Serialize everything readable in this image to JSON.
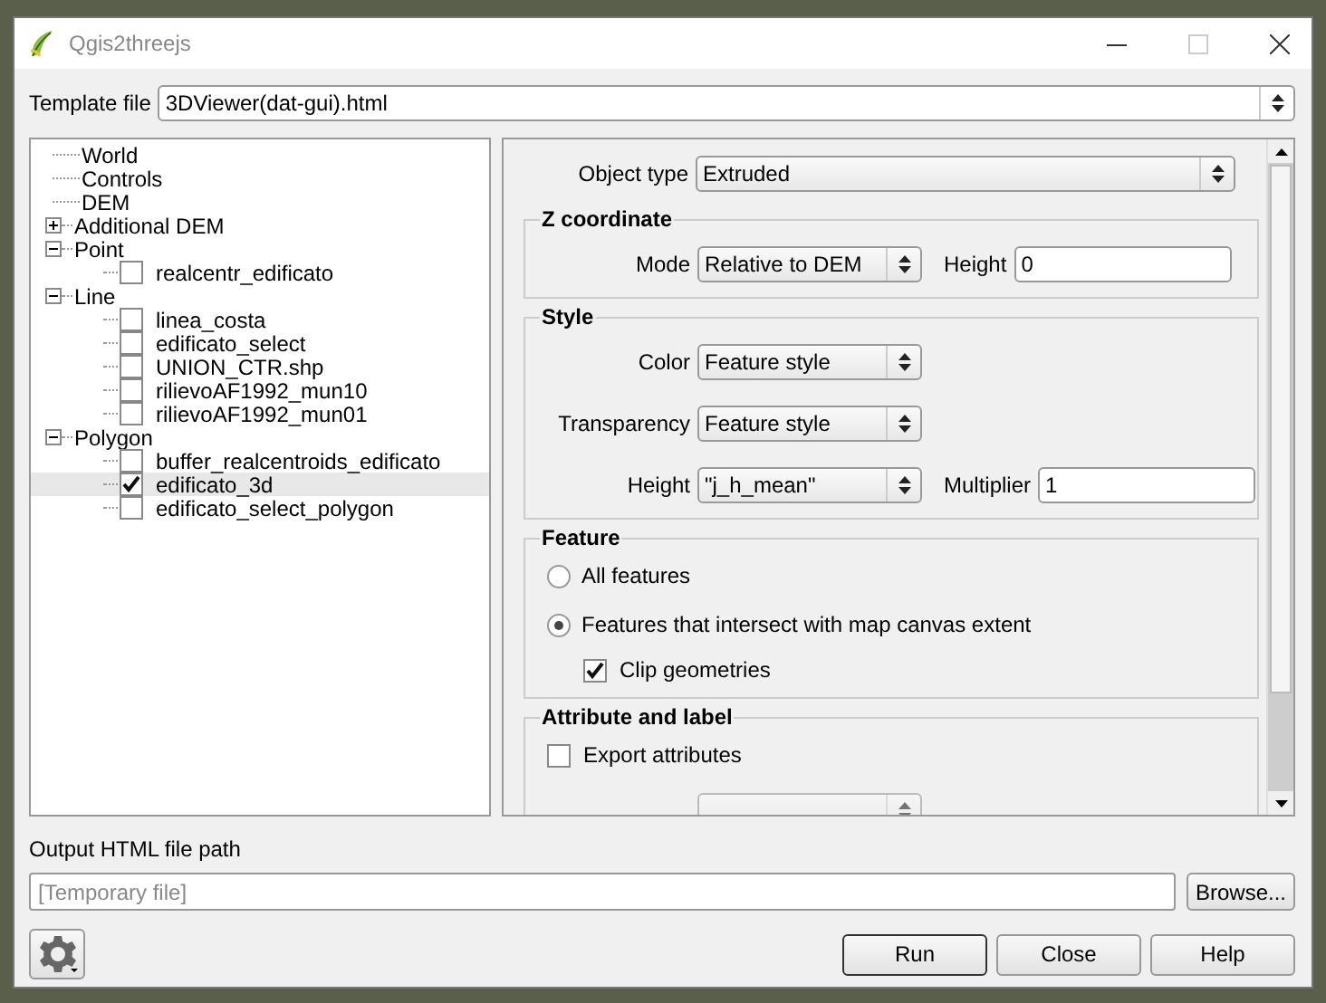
{
  "window": {
    "title": "Qgis2threejs"
  },
  "template": {
    "label": "Template file",
    "value": "3DViewer(dat-gui).html"
  },
  "tree": [
    {
      "label": "World",
      "selected": false
    },
    {
      "label": "Controls",
      "selected": false
    },
    {
      "label": "DEM",
      "selected": false
    },
    {
      "label": "Additional DEM",
      "selected": false,
      "expanded": false
    },
    {
      "label": "Point",
      "selected": false,
      "expanded": true,
      "children": [
        {
          "label": "realcentr_edificato",
          "checked": false,
          "selected": false
        }
      ]
    },
    {
      "label": "Line",
      "selected": false,
      "expanded": true,
      "children": [
        {
          "label": "linea_costa",
          "checked": false,
          "selected": false
        },
        {
          "label": "edificato_select",
          "checked": false,
          "selected": false
        },
        {
          "label": "UNION_CTR.shp",
          "checked": false,
          "selected": false
        },
        {
          "label": "rilievoAF1992_mun10",
          "checked": false,
          "selected": false
        },
        {
          "label": "rilievoAF1992_mun01",
          "checked": false,
          "selected": false
        }
      ]
    },
    {
      "label": "Polygon",
      "selected": false,
      "expanded": true,
      "children": [
        {
          "label": "buffer_realcentroids_edificato",
          "checked": false,
          "selected": false
        },
        {
          "label": "edificato_3d",
          "checked": true,
          "selected": true
        },
        {
          "label": "edificato_select_polygon",
          "checked": false,
          "selected": false
        }
      ]
    }
  ],
  "object_type": {
    "label": "Object type",
    "value": "Extruded"
  },
  "sections": [
    {
      "title": "Z coordinate",
      "rows": [
        {
          "kind": "combo_input",
          "label": "Mode",
          "value": "Relative to DEM",
          "field_label": "Height",
          "field_value": "0"
        }
      ]
    },
    {
      "title": "Style",
      "rows": [
        {
          "kind": "combo",
          "label": "Color",
          "value": "Feature style"
        },
        {
          "kind": "combo",
          "label": "Transparency",
          "value": "Feature style"
        },
        {
          "kind": "combo_input",
          "label": "Height",
          "value": "\"j_h_mean\"",
          "field_label": "Multiplier",
          "field_value": "1"
        }
      ]
    },
    {
      "title": "Feature",
      "rows": [
        {
          "kind": "radio",
          "label": "All features",
          "selected": false
        },
        {
          "kind": "radio",
          "label": "Features that intersect with map canvas extent",
          "selected": true,
          "children": [
            {
              "kind": "checkbox",
              "label": "Clip geometries",
              "checked": true
            }
          ]
        }
      ]
    },
    {
      "title": "Attribute and label",
      "rows": [
        {
          "kind": "checkbox",
          "label": "Export attributes",
          "checked": false
        },
        {
          "kind": "combo",
          "disabled": true
        }
      ]
    }
  ],
  "output": {
    "label": "Output HTML file path",
    "placeholder": "[Temporary file]",
    "browse": "Browse..."
  },
  "buttons": [
    "Run",
    "Close",
    "Help"
  ]
}
